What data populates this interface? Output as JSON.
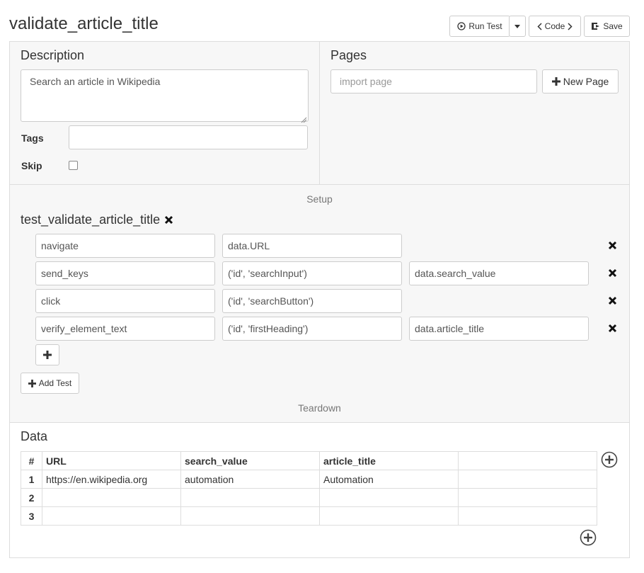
{
  "header": {
    "title": "validate_article_title",
    "run_test_label": "Run Test",
    "code_label": "Code",
    "save_label": "Save"
  },
  "description": {
    "heading": "Description",
    "value": "Search an article in Wikipedia",
    "tags_label": "Tags",
    "tags_value": "",
    "skip_label": "Skip"
  },
  "pages": {
    "heading": "Pages",
    "import_placeholder": "import page",
    "new_page_label": "New Page"
  },
  "setup_label": "Setup",
  "test": {
    "name": "test_validate_article_title",
    "steps": [
      {
        "action": "navigate",
        "arg1": "data.URL",
        "arg2": ""
      },
      {
        "action": "send_keys",
        "arg1": "('id', 'searchInput')",
        "arg2": "data.search_value"
      },
      {
        "action": "click",
        "arg1": "('id', 'searchButton')",
        "arg2": ""
      },
      {
        "action": "verify_element_text",
        "arg1": "('id', 'firstHeading')",
        "arg2": "data.article_title"
      }
    ],
    "add_test_label": "Add Test"
  },
  "teardown_label": "Teardown",
  "data": {
    "heading": "Data",
    "columns": [
      "#",
      "URL",
      "search_value",
      "article_title",
      ""
    ],
    "rows": [
      [
        "1",
        "https://en.wikipedia.org",
        "automation",
        "Automation",
        ""
      ],
      [
        "2",
        "",
        "",
        "",
        ""
      ],
      [
        "3",
        "",
        "",
        "",
        ""
      ]
    ]
  }
}
